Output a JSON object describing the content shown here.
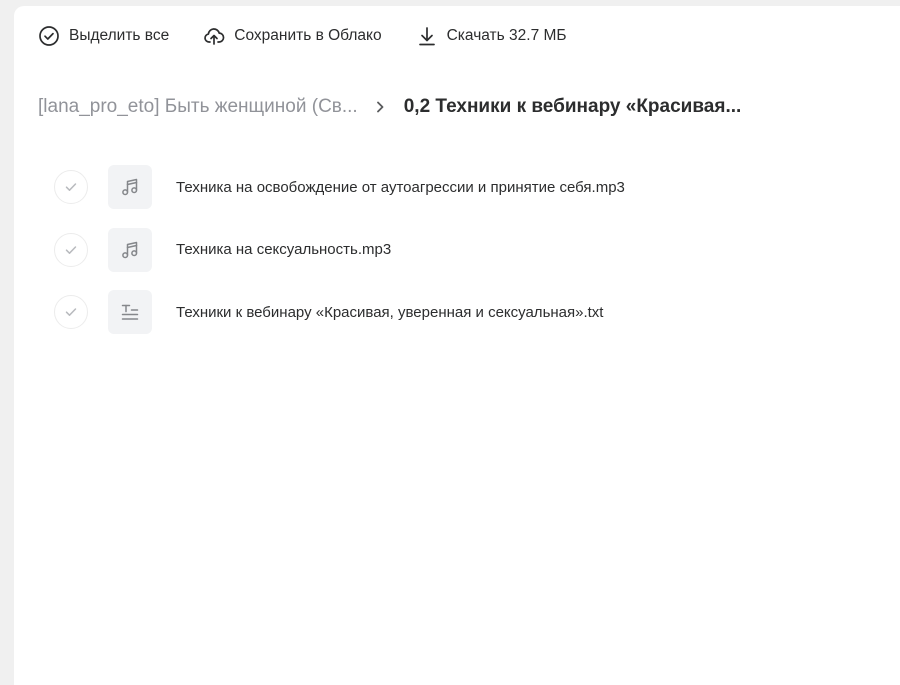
{
  "toolbar": {
    "select_all": {
      "label": "Выделить все",
      "icon": "check-circle-icon"
    },
    "save_to_cloud": {
      "label": "Сохранить в Облако",
      "icon": "cloud-upload-icon"
    },
    "download": {
      "label": "Скачать 32.7 МБ",
      "icon": "download-icon"
    }
  },
  "breadcrumb": {
    "parent": "[lana_pro_eto] Быть женщиной (Св...",
    "separator_icon": "chevron-right-icon",
    "current": "0,2 Техники к вебинару «Красивая..."
  },
  "files": [
    {
      "name": "Техника на освобождение от аутоагрессии и принятие себя.mp3",
      "type": "audio",
      "icon": "music-note-icon"
    },
    {
      "name": "Техника на сексуальность.mp3",
      "type": "audio",
      "icon": "music-note-icon"
    },
    {
      "name": "Техники к вебинару «Красивая, уверенная и сексуальная».txt",
      "type": "text",
      "icon": "text-file-icon"
    }
  ],
  "colors": {
    "text_primary": "#2c2d2e",
    "text_secondary": "#919399",
    "icon_bg": "#f2f3f5"
  }
}
